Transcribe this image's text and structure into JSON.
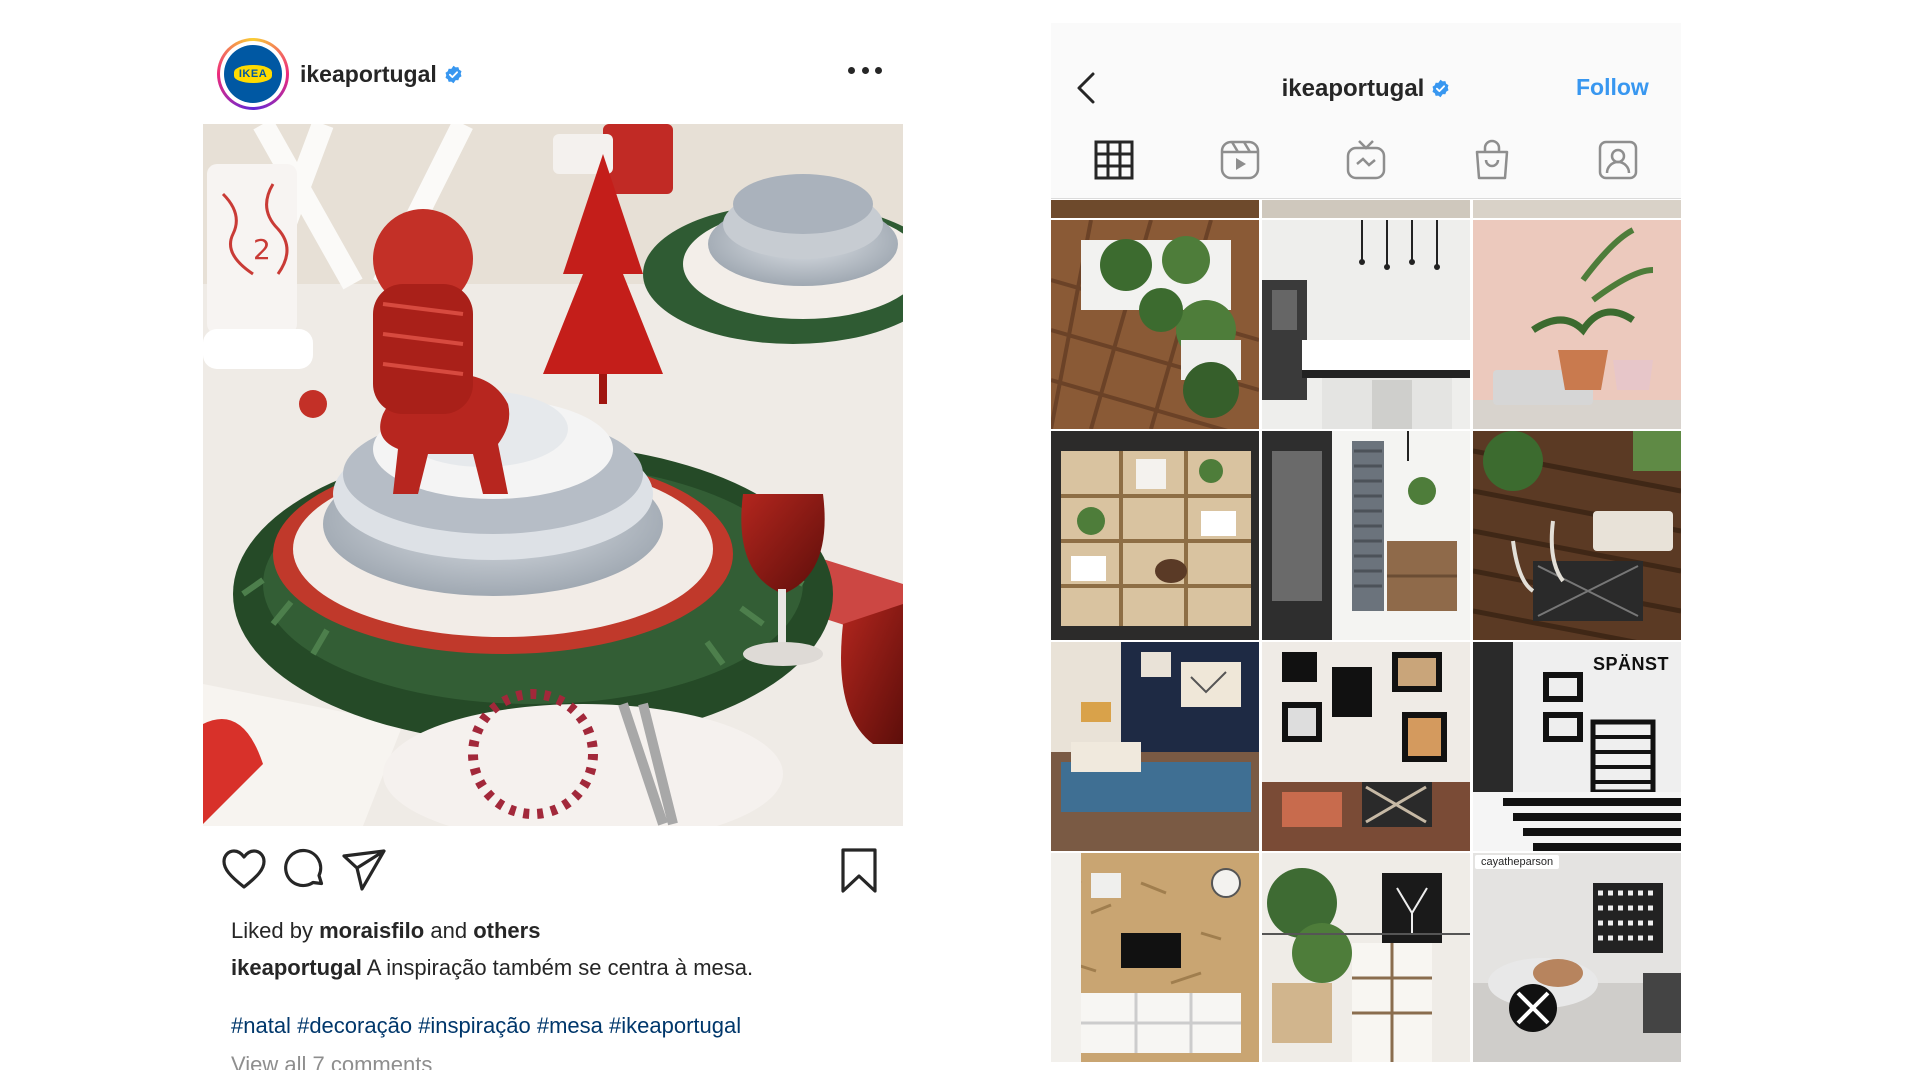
{
  "post": {
    "username": "ikeaportugal",
    "avatar_logo_text": "IKEA",
    "icons": {
      "like": "heart-icon",
      "comment": "comment-icon",
      "share": "paper-plane-icon",
      "save": "bookmark-icon",
      "more": "more-dots-icon",
      "verified": "verified-badge-icon"
    },
    "liked_prefix": "Liked by",
    "liked_user": "moraisfilo",
    "liked_and": "and",
    "liked_others": "others",
    "caption_user": "ikeaportugal",
    "caption_text": "A inspiração também se centra à mesa.",
    "hashtags": [
      "#natal",
      "#decoração",
      "#inspiração",
      "#mesa",
      "#ikeaportugal"
    ],
    "view_comments": "View all 7 comments"
  },
  "profile": {
    "title": "ikeaportugal",
    "follow_label": "Follow",
    "tabs": [
      "grid-icon",
      "reels-icon",
      "igtv-icon",
      "shop-icon",
      "tagged-icon"
    ],
    "tile_labels": {
      "spanst": "SPÄNST",
      "cayatheparson": "cayatheparson"
    },
    "colors": {
      "accent": "#3897f0",
      "hashtag": "#00376b",
      "verified": "#3897f0"
    }
  }
}
